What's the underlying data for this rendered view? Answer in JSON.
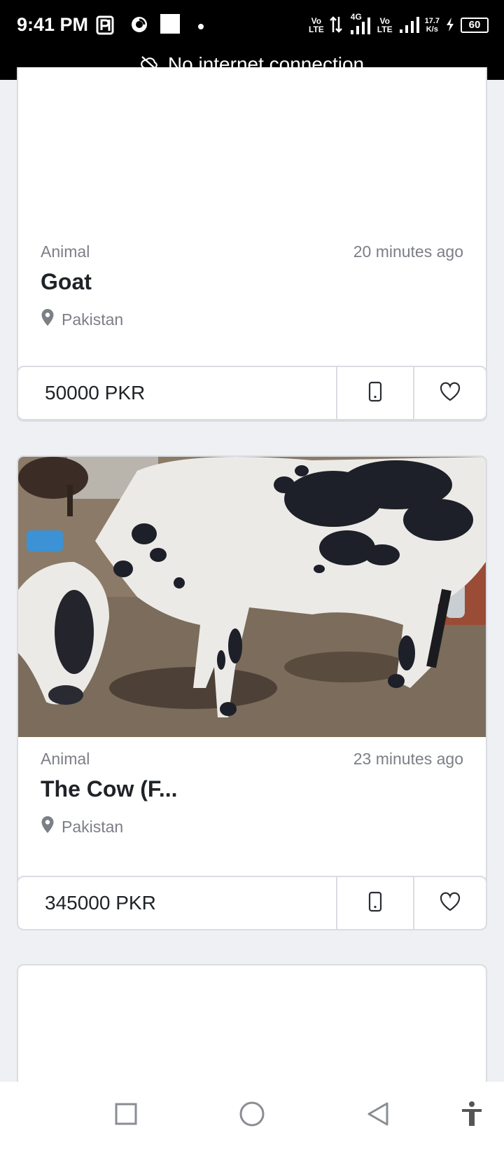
{
  "status_bar": {
    "time": "9:41 PM",
    "volte1": "Vo\nLTE",
    "network": "4G",
    "volte2": "Vo\nLTE",
    "speed": "17.7\nK/s",
    "battery": "60"
  },
  "banner": {
    "text": "No internet connection"
  },
  "listings": [
    {
      "category": "Animal",
      "posted": "20 minutes ago",
      "title": "Goat",
      "location": "Pakistan",
      "price": "50000 PKR"
    },
    {
      "category": "Animal",
      "posted": "23 minutes ago",
      "title": "The Cow (F...",
      "location": "Pakistan",
      "price": "345000 PKR"
    }
  ],
  "colors": {
    "status_bg": "#000000",
    "page_bg": "#eef0f3",
    "card_border": "#d9dce1",
    "text_muted": "#7c7f86",
    "text_dark": "#1f2328"
  },
  "icons": [
    "cloud-off-icon",
    "location-pin-icon",
    "phone-icon",
    "heart-icon",
    "square-nav-icon",
    "circle-nav-icon",
    "back-nav-icon",
    "accessibility-icon"
  ]
}
